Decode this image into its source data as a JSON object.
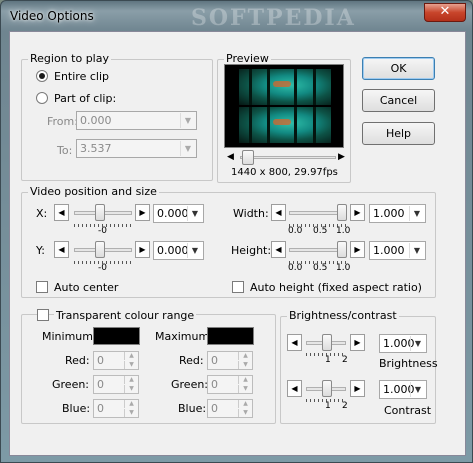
{
  "window": {
    "title": "Video Options",
    "watermark": "SOFTPEDIA",
    "close_label": "✕"
  },
  "region": {
    "legend": "Region to play",
    "entire_clip": "Entire clip",
    "part_of_clip": "Part of clip:",
    "selected": "entire_clip",
    "from_label": "From:",
    "from_value": "0.000",
    "to_label": "To:",
    "to_value": "3.537"
  },
  "preview": {
    "legend": "Preview",
    "resolution": "1440 x 800, 29.97fps"
  },
  "buttons": {
    "ok": "OK",
    "cancel": "Cancel",
    "help": "Help"
  },
  "position": {
    "legend": "Video position and size",
    "x_label": "X:",
    "x_value": "0.000",
    "x_tick": "-0",
    "y_label": "Y:",
    "y_value": "0.000",
    "y_tick": "-0",
    "width_label": "Width:",
    "width_value": "1.000",
    "height_label": "Height:",
    "height_value": "1.000",
    "scale_ticks": [
      "0.0",
      "0.5",
      "1.0"
    ],
    "auto_center": "Auto center",
    "auto_height": "Auto height (fixed aspect ratio)"
  },
  "transparent": {
    "legend": "Transparent colour range",
    "minimum_label": "Minimum:",
    "maximum_label": "Maximum:",
    "min_color": "#000000",
    "max_color": "#000000",
    "red_label": "Red:",
    "green_label": "Green:",
    "blue_label": "Blue:",
    "min_red": "0",
    "min_green": "0",
    "min_blue": "0",
    "max_red": "0",
    "max_green": "0",
    "max_blue": "0"
  },
  "bc": {
    "legend": "Brightness/contrast",
    "brightness_value": "1.000",
    "brightness_label": "Brightness",
    "contrast_value": "1.000",
    "contrast_label": "Contrast",
    "tick_1": "1",
    "tick_2": "2"
  },
  "icons": {
    "left": "◀",
    "right": "▶",
    "down": "▼",
    "up": "▲"
  }
}
